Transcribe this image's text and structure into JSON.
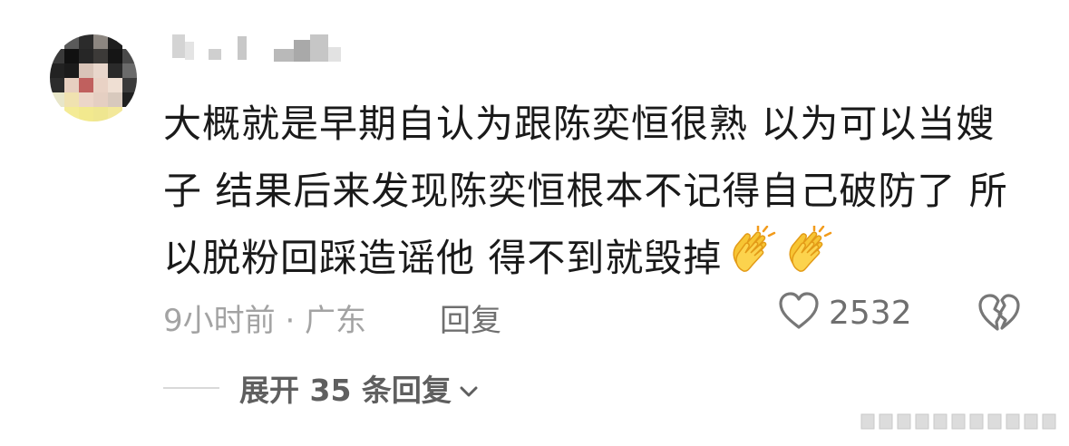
{
  "comment": {
    "text_line1": "大概就是早期自认为跟陈奕恒很熟 以为可以当嫂",
    "text_line2": "子 结果后来发现陈奕恒根本不记得自己破防了 所",
    "text_line3": "以脱粉回踩造谣他 得不到就毁掉",
    "time_location": "9小时前 · 广东",
    "reply_label": "回复",
    "like_count": "2532",
    "expand_label": "展开 35 条回复"
  },
  "icons": {
    "emoji": [
      "clapping-hands-icon",
      "clapping-hands-icon"
    ],
    "like": "heart-outline-icon",
    "dislike": "broken-heart-icon",
    "expand": "chevron-down-icon"
  },
  "colors": {
    "text": "#1a1a1a",
    "meta": "#a3a3a3",
    "secondary": "#6f6f6f",
    "divider": "#d9d9d9",
    "emoji": "#f7c534"
  }
}
